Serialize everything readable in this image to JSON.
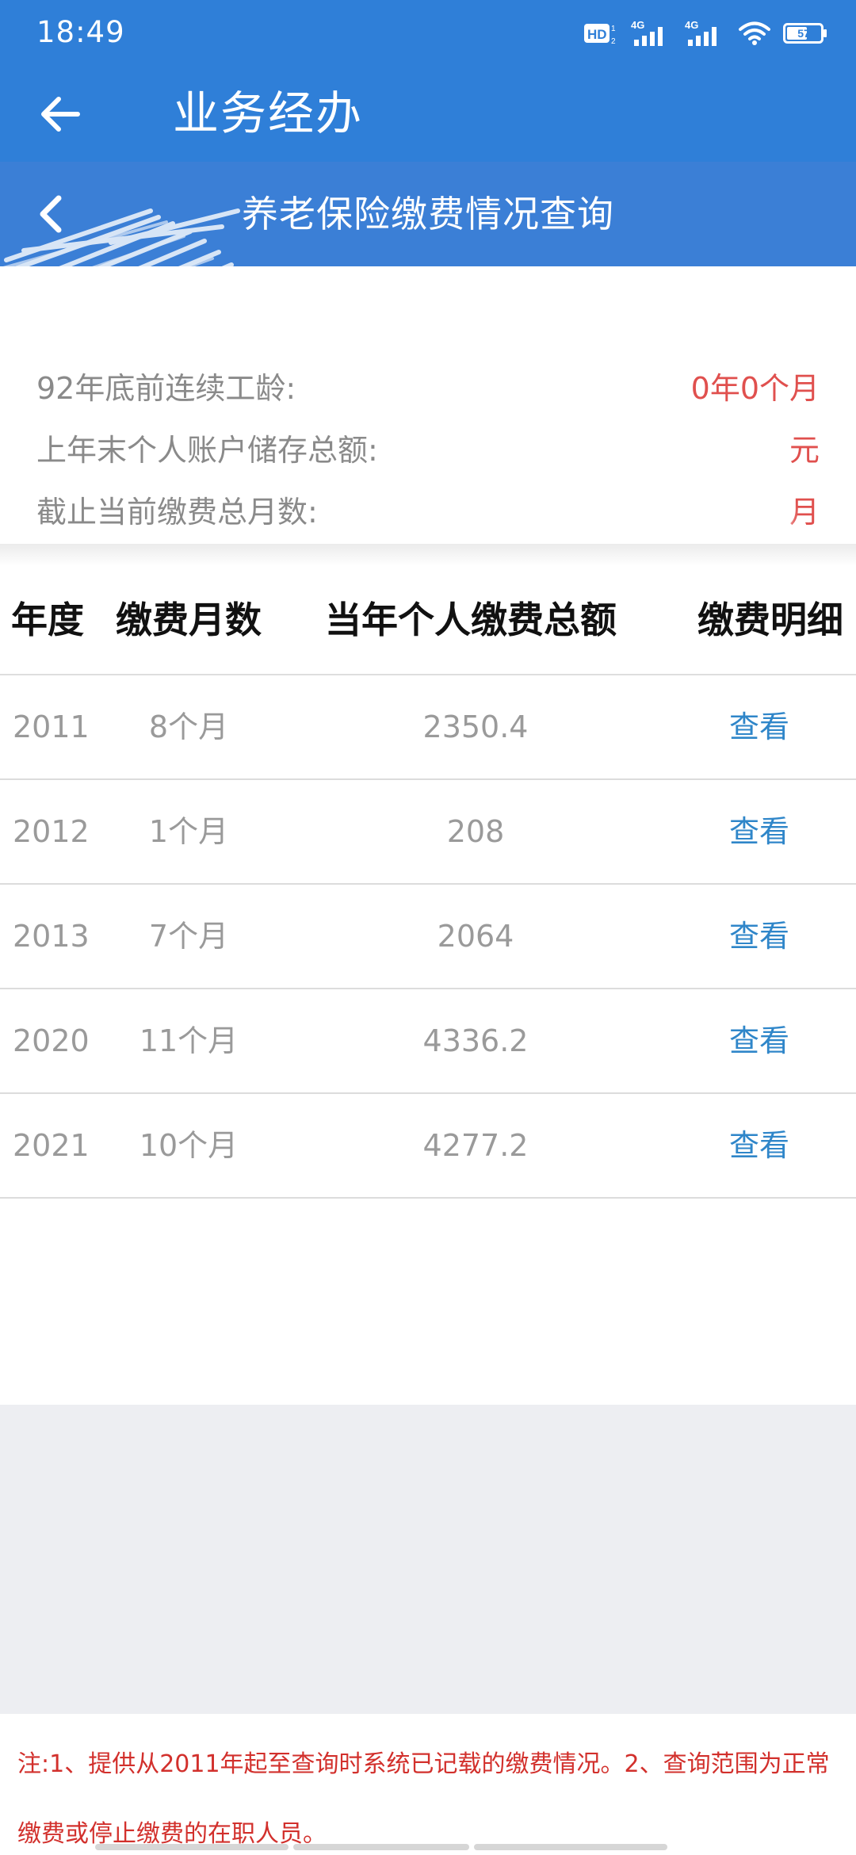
{
  "status_bar": {
    "time": "18:49",
    "battery": "57",
    "icons": [
      "hd-icon",
      "signal-4g-icon",
      "signal-4g-icon",
      "wifi-icon",
      "battery-icon"
    ],
    "network_label": "4G"
  },
  "app_bar": {
    "title": "业务经办",
    "back_icon": "arrow-left-icon"
  },
  "sub_header": {
    "title": "养老保险缴费情况查询",
    "back_icon": "chevron-left-icon"
  },
  "summary": {
    "rows": [
      {
        "label": "92年底前连续工龄:",
        "value": "0年0个月"
      },
      {
        "label": "上年末个人账户储存总额:",
        "value": "元"
      },
      {
        "label": "截止当前缴费总月数:",
        "value": "月"
      }
    ]
  },
  "table": {
    "headers": {
      "year": "年度",
      "months": "缴费月数",
      "total": "当年个人缴费总额",
      "detail": "缴费明细"
    },
    "rows": [
      {
        "year": "2011",
        "months": "8个月",
        "total": "2350.4",
        "action": "查看"
      },
      {
        "year": "2012",
        "months": "1个月",
        "total": "208",
        "action": "查看"
      },
      {
        "year": "2013",
        "months": "7个月",
        "total": "2064",
        "action": "查看"
      },
      {
        "year": "2020",
        "months": "11个月",
        "total": "4336.2",
        "action": "查看"
      },
      {
        "year": "2021",
        "months": "10个月",
        "total": "4277.2",
        "action": "查看"
      }
    ]
  },
  "note": {
    "line1": "注:1、提供从2011年起至查询时系统已记载的缴费情况。2、查询范围为正常",
    "line2": "缴费或停止缴费的在职人员。"
  },
  "colors": {
    "primary": "#2f7fd8",
    "value_red": "#e0504e",
    "link_blue": "#2f86c9",
    "note_red": "#d2302c"
  }
}
